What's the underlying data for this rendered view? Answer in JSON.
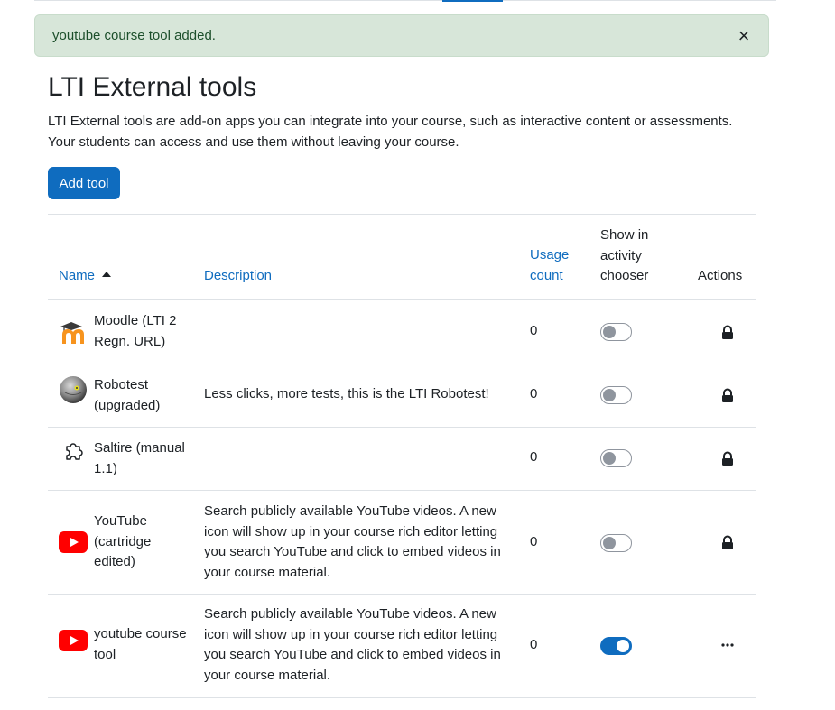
{
  "alert": {
    "message": "youtube course tool added.",
    "close_glyph": "×",
    "background": "#d7e6d9"
  },
  "page": {
    "title": "LTI External tools",
    "intro": "LTI External tools are add-on apps you can integrate into your course, such as interactive content or assessments. Your students can access and use them without leaving your course."
  },
  "toolbar": {
    "add_label": "Add tool",
    "accent": "#0f6cbf"
  },
  "table": {
    "headers": {
      "name": "Name",
      "description": "Description",
      "usage": "Usage count",
      "show": "Show in activity chooser",
      "actions": "Actions"
    },
    "sort": {
      "column": "name",
      "direction": "ascending"
    },
    "rows": [
      {
        "icon": "moodle-logo-icon",
        "name": "Moodle (LTI 2 Regn. URL)",
        "description": "",
        "usage": "0",
        "show_in_chooser": false,
        "action": "lock-icon"
      },
      {
        "icon": "robot-ball-icon",
        "name": "Robotest (upgraded)",
        "description": "Less clicks, more tests, this is the LTI Robotest!",
        "usage": "0",
        "show_in_chooser": false,
        "action": "lock-icon"
      },
      {
        "icon": "puzzle-piece-icon",
        "name": "Saltire (manual 1.1)",
        "description": "",
        "usage": "0",
        "show_in_chooser": false,
        "action": "lock-icon"
      },
      {
        "icon": "youtube-icon",
        "name": "YouTube (cartridge edited)",
        "description": "Search publicly available YouTube videos. A new icon will show up in your course rich editor letting you search YouTube and click to embed videos in your course material.",
        "usage": "0",
        "show_in_chooser": false,
        "action": "lock-icon"
      },
      {
        "icon": "youtube-icon",
        "name": "youtube course tool",
        "description": "Search publicly available YouTube videos. A new icon will show up in your course rich editor letting you search YouTube and click to embed videos in your course material.",
        "usage": "0",
        "show_in_chooser": true,
        "action": "more-options-icon"
      }
    ]
  }
}
